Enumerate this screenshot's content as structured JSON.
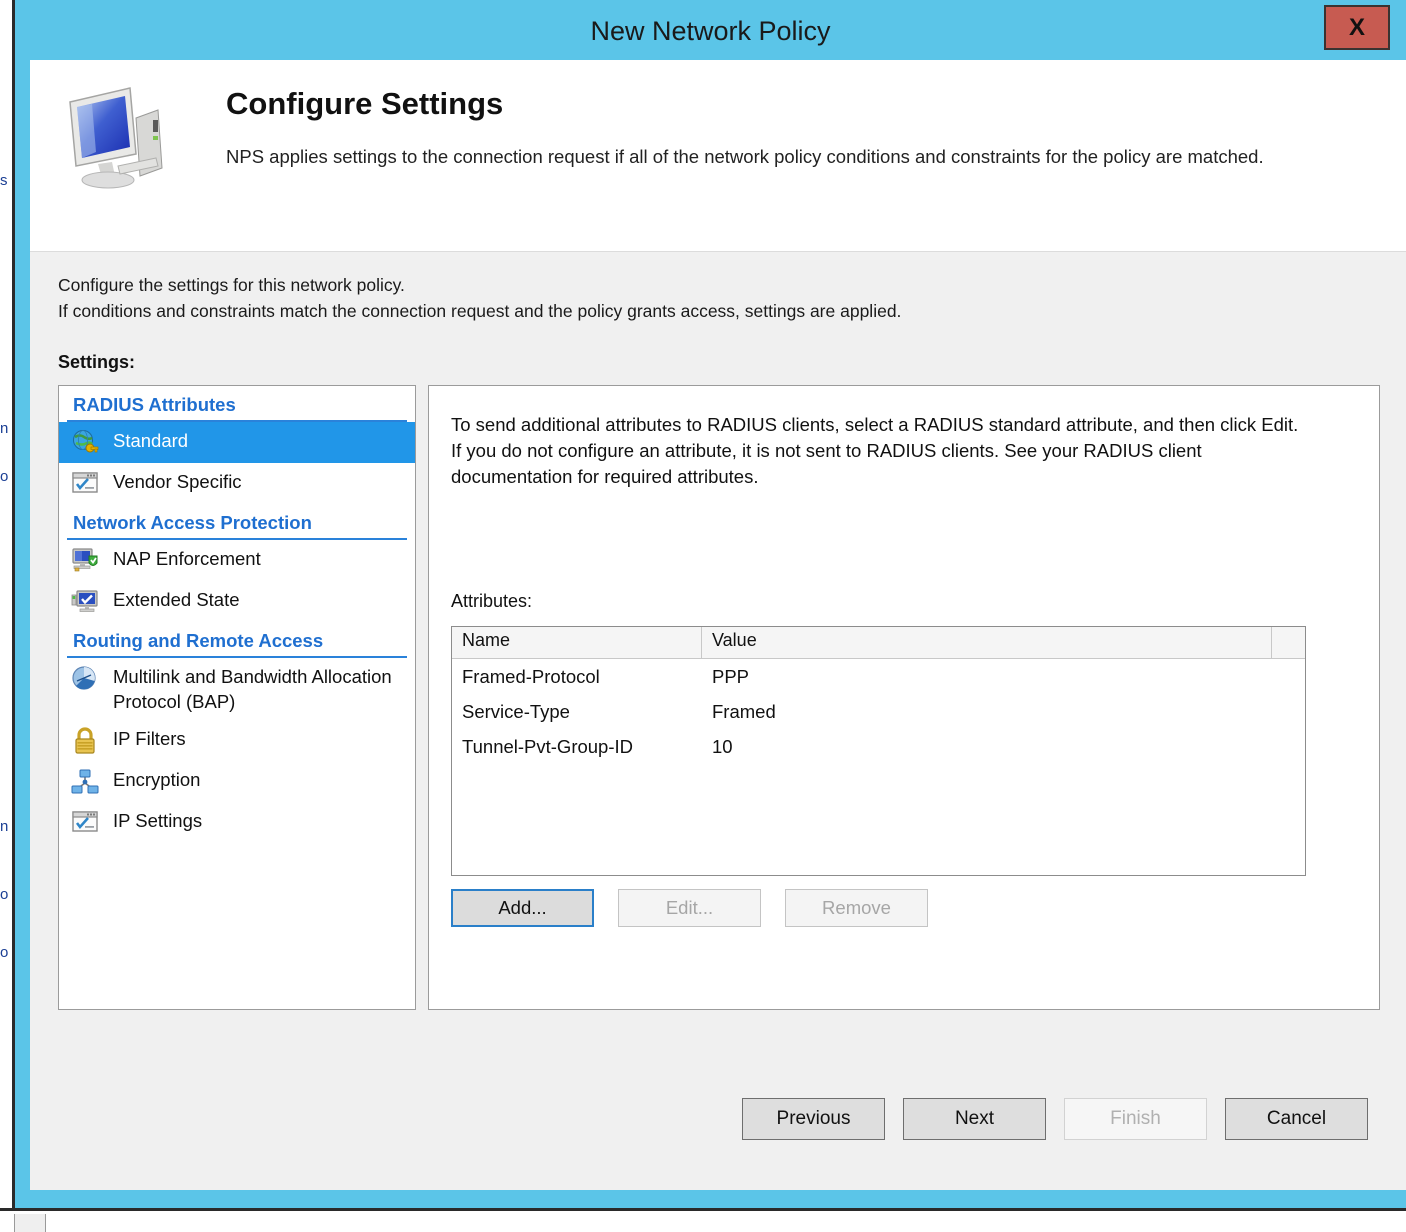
{
  "window": {
    "title": "New Network Policy",
    "close_label": "X",
    "close_bg": "#c75b51",
    "frame_color": "#5bc5e8"
  },
  "header": {
    "icon": "computer-monitor-icon",
    "title": "Configure Settings",
    "subtitle": "NPS applies settings to the connection request if all of the network policy conditions and constraints for the policy are matched."
  },
  "instructions": {
    "line1": "Configure the settings for this network policy.",
    "line2": "If conditions and constraints match the connection request and the policy grants access, settings are applied."
  },
  "settings": {
    "label": "Settings:",
    "groups": [
      {
        "heading": "RADIUS Attributes",
        "items": [
          {
            "label": "Standard",
            "icon": "globe-key-icon",
            "selected": true
          },
          {
            "label": "Vendor Specific",
            "icon": "window-check-icon",
            "selected": false
          }
        ]
      },
      {
        "heading": "Network Access Protection",
        "items": [
          {
            "label": "NAP Enforcement",
            "icon": "monitor-shield-icon",
            "selected": false
          },
          {
            "label": "Extended State",
            "icon": "monitor-check-icon",
            "selected": false
          }
        ]
      },
      {
        "heading": "Routing and Remote Access",
        "items": [
          {
            "label": "Multilink and Bandwidth Allocation Protocol (BAP)",
            "icon": "pie-chart-icon",
            "selected": false
          },
          {
            "label": "IP Filters",
            "icon": "padlock-icon",
            "selected": false
          },
          {
            "label": "Encryption",
            "icon": "network-nodes-icon",
            "selected": false
          },
          {
            "label": "IP Settings",
            "icon": "window-check-icon",
            "selected": false
          }
        ]
      }
    ]
  },
  "detail": {
    "description": "To send additional attributes to RADIUS clients, select a RADIUS standard attribute, and then click Edit. If you do not configure an attribute, it is not sent to RADIUS clients. See your RADIUS client documentation for required attributes.",
    "attributes_label": "Attributes:",
    "columns": [
      "Name",
      "Value"
    ],
    "rows": [
      {
        "name": "Framed-Protocol",
        "value": "PPP"
      },
      {
        "name": "Service-Type",
        "value": "Framed"
      },
      {
        "name": "Tunnel-Pvt-Group-ID",
        "value": "10"
      }
    ],
    "buttons": {
      "add": "Add...",
      "edit": "Edit...",
      "remove": "Remove"
    }
  },
  "footer": {
    "previous": "Previous",
    "next": "Next",
    "finish": "Finish",
    "cancel": "Cancel"
  },
  "background": {
    "ghost_lines": [
      "s",
      "n",
      "o",
      "n",
      "o",
      "o"
    ]
  }
}
